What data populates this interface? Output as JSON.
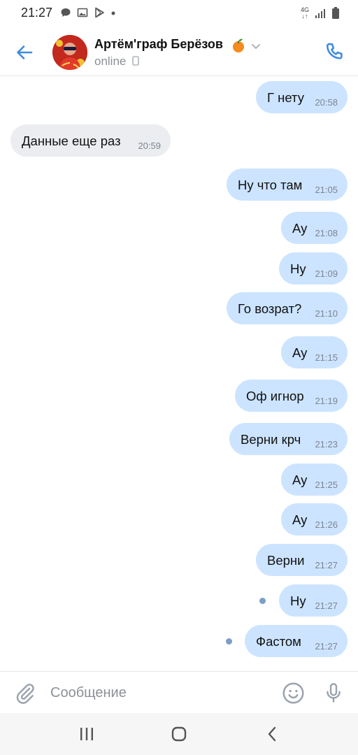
{
  "status_bar": {
    "time": "21:27",
    "network": "4G"
  },
  "header": {
    "name": "Артём'граф Берёзов",
    "status": "online"
  },
  "messages": [
    {
      "text": "Г нету",
      "time": "20:58",
      "dir": "out"
    },
    {
      "text": "Данные еще раз",
      "time": "20:59",
      "dir": "in"
    },
    {
      "text": "Ну что там",
      "time": "21:05",
      "dir": "out"
    },
    {
      "text": "Ау",
      "time": "21:08",
      "dir": "out"
    },
    {
      "text": "Ну",
      "time": "21:09",
      "dir": "out"
    },
    {
      "text": "Го возрат?",
      "time": "21:10",
      "dir": "out"
    },
    {
      "text": "Ау",
      "time": "21:15",
      "dir": "out"
    },
    {
      "text": "Оф игнор",
      "time": "21:19",
      "dir": "out"
    },
    {
      "text": "Верни крч",
      "time": "21:23",
      "dir": "out"
    },
    {
      "text": "Ау",
      "time": "21:25",
      "dir": "out"
    },
    {
      "text": "Ау",
      "time": "21:26",
      "dir": "out"
    },
    {
      "text": "Верни",
      "time": "21:27",
      "dir": "out"
    },
    {
      "text": "Ну",
      "time": "21:27",
      "dir": "out",
      "unread": true
    },
    {
      "text": "Фастом",
      "time": "21:27",
      "dir": "out",
      "unread": true
    }
  ],
  "composer": {
    "placeholder": "Сообщение"
  },
  "colors": {
    "accent": "#3f8ae0",
    "outgoing_bubble": "#cce4ff",
    "incoming_bubble": "#ebedf0",
    "unread_dot": "#7b9ec4"
  }
}
